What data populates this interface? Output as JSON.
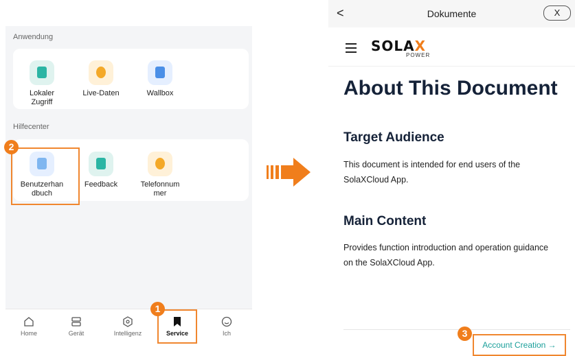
{
  "left_app": {
    "section_application": "Anwendung",
    "application_items": [
      {
        "label": "Lokaler\nZugriff",
        "icon": "local-access-icon",
        "color": "#2bb5a4",
        "bg": "#dff3ef"
      },
      {
        "label": "Live-Daten",
        "icon": "live-data-icon",
        "color": "#f4a928",
        "bg": "#fff1d8"
      },
      {
        "label": "Wallbox",
        "icon": "wallbox-icon",
        "color": "#4a8fe7",
        "bg": "#e5efff"
      }
    ],
    "section_help": "Hilfecenter",
    "help_items": [
      {
        "label": "Benutzerhan\ndbuch",
        "icon": "user-manual-icon",
        "color": "#7fb6f0",
        "bg": "#e5efff"
      },
      {
        "label": "Feedback",
        "icon": "feedback-icon",
        "color": "#2bb5a4",
        "bg": "#dff3ef"
      },
      {
        "label": "Telefonnum\nmer",
        "icon": "phone-icon",
        "color": "#f4a928",
        "bg": "#fff1d8"
      }
    ],
    "tabs": [
      {
        "label": "Home",
        "icon": "home-icon"
      },
      {
        "label": "Gerät",
        "icon": "device-icon"
      },
      {
        "label": "Intelligenz",
        "icon": "intelligence-icon"
      },
      {
        "label": "Service",
        "icon": "service-icon",
        "active": true
      },
      {
        "label": "Ich",
        "icon": "profile-icon"
      }
    ],
    "badges": [
      "1",
      "2",
      "3"
    ]
  },
  "doc_view": {
    "title": "Dokumente",
    "back_symbol": "<",
    "close_symbol": "X",
    "logo_main": "SOLA",
    "logo_x": "X",
    "logo_sub": "POWER",
    "heading": "About This Document",
    "section1_title": "Target Audience",
    "section1_text": "This document is intended for end users of the SolaXCloud App.",
    "section2_title": "Main Content",
    "section2_text": "Provides function introduction and operation guidance on the SolaXCloud App.",
    "next_link": "Account Creation →"
  },
  "colors": {
    "accent": "#f07e1c",
    "link": "#1a9f9a",
    "heading": "#152238"
  }
}
